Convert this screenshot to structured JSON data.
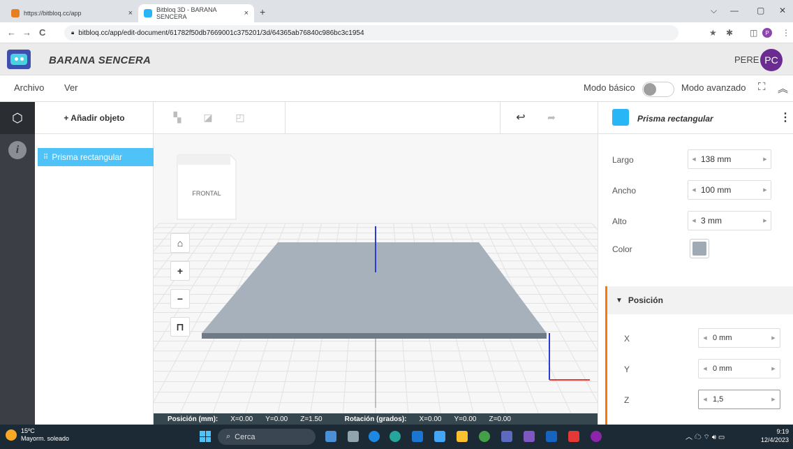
{
  "browser": {
    "tabs": [
      {
        "title": "https://bitbloq.cc/app"
      },
      {
        "title": "Bitbloq 3D - BARANA SENCERA"
      }
    ],
    "close_glyph": "×",
    "new_tab_glyph": "+",
    "url": "bitbloq.cc/app/edit-document/61782f50db7669001c375201/3d/64365ab76840c986bc3c1954",
    "window_controls": [
      "⌵",
      "—",
      "▢",
      "✕"
    ],
    "nav": {
      "back": "←",
      "forward": "→",
      "reload": "C"
    },
    "profile_initial": "P"
  },
  "app": {
    "document_title": "BARANA SENCERA",
    "user_name": "PERE",
    "user_initials": "PC"
  },
  "menubar": {
    "items": [
      "Archivo",
      "Ver"
    ],
    "mode_basic": "Modo básico",
    "mode_advanced": "Modo avanzado",
    "advanced_enabled": false
  },
  "objects": {
    "add_label": "+ Añadir objeto",
    "items": [
      {
        "label": "Prisma rectangular",
        "selected": true
      }
    ]
  },
  "viewport": {
    "cube_face_label": "FRONTAL",
    "object_color": "#a7b1bb",
    "status": {
      "position_label": "Posición (mm):",
      "pos_x": "X=0.00",
      "pos_y": "Y=0.00",
      "pos_z": "Z=1.50",
      "rotation_label": "Rotación (grados):",
      "rot_x": "X=0.00",
      "rot_y": "Y=0.00",
      "rot_z": "Z=0.00"
    }
  },
  "properties": {
    "title": "Prisma rectangular",
    "fields": [
      {
        "label": "Largo",
        "value": "138 mm"
      },
      {
        "label": "Ancho",
        "value": "100 mm"
      },
      {
        "label": "Alto",
        "value": "3 mm"
      }
    ],
    "color_label": "Color",
    "color_value": "#a0aab4",
    "position": {
      "header": "Posición",
      "fields": [
        {
          "label": "X",
          "value": "0 mm"
        },
        {
          "label": "Y",
          "value": "0 mm"
        },
        {
          "label": "Z",
          "value": "1,5"
        }
      ]
    }
  },
  "taskbar": {
    "temperature": "15ºC",
    "weather": "Mayorm. soleado",
    "search": "Cerca",
    "time": "9:19",
    "date": "12/4/2023"
  }
}
